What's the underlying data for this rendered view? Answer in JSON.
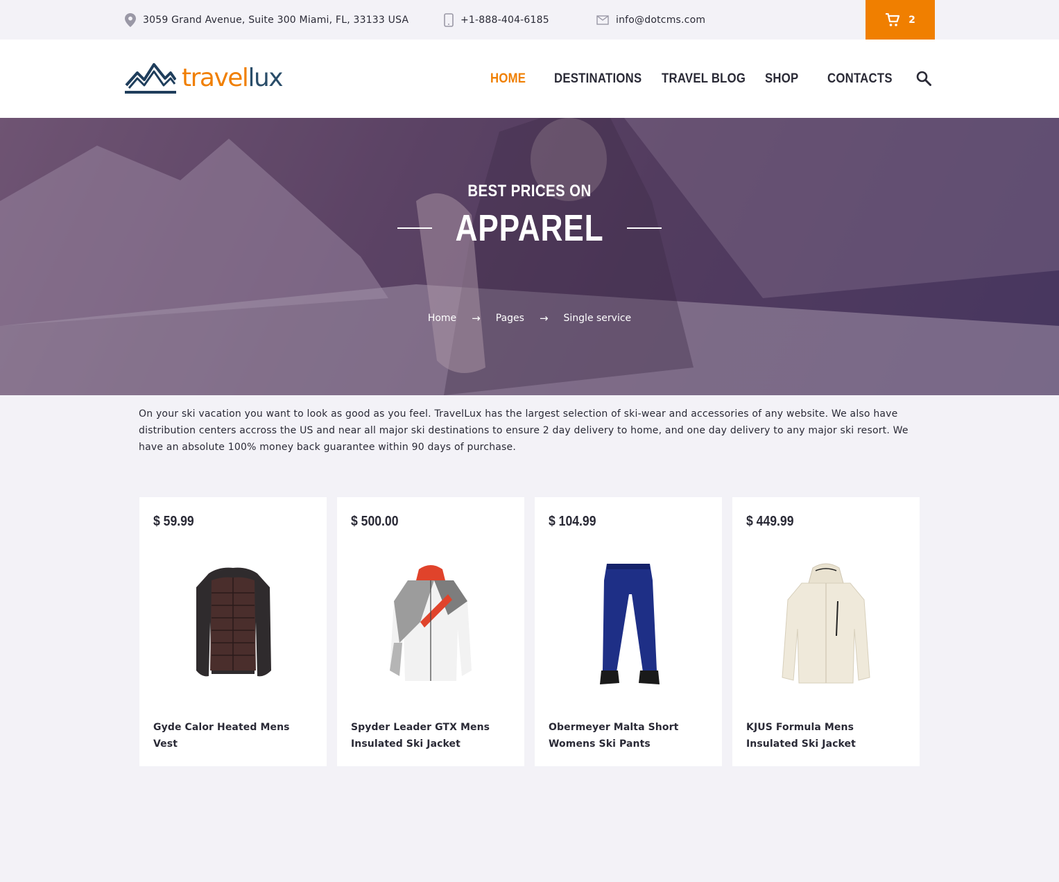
{
  "topbar": {
    "address": "3059 Grand Avenue, Suite 300 Miami, FL, 33133 USA",
    "phone": "+1-888-404-6185",
    "email": "info@dotcms.com",
    "cart_count": "2",
    "address_icon": "location-pin-icon",
    "phone_icon": "mobile-phone-icon",
    "email_icon": "envelope-icon",
    "cart_icon": "shopping-cart-icon"
  },
  "header": {
    "logo_part1": "travel",
    "logo_part2": "lux",
    "logo_icon": "mountains-logo-icon",
    "nav": [
      {
        "label": "HOME",
        "active": true
      },
      {
        "label": "DESTINATIONS",
        "active": false
      },
      {
        "label": "TRAVEL BLOG",
        "active": false
      },
      {
        "label": "SHOP",
        "active": false
      },
      {
        "label": "CONTACTS",
        "active": false
      }
    ],
    "search_icon": "search-icon"
  },
  "hero": {
    "subtitle": "BEST PRICES ON",
    "title": "APPAREL",
    "breadcrumbs": [
      "Home",
      "Pages",
      "Single service"
    ],
    "separator": "→"
  },
  "intro": {
    "text": "On your ski vacation you want to look as good as you feel. TravelLux has the largest selection of ski-wear and accessories of any website. We also have distribution centers accross the US and near all major ski destinations to ensure 2 day delivery to home, and one day delivery to any major ski resort. We have an absolute 100% money back guarantee within 90 days of purchase."
  },
  "products": [
    {
      "price": "$ 59.99",
      "name": "Gyde Calor Heated Mens Vest"
    },
    {
      "price": "$ 500.00",
      "name": "Spyder Leader GTX Mens Insulated Ski Jacket"
    },
    {
      "price": "$ 104.99",
      "name": "Obermeyer Malta Short Womens Ski Pants"
    },
    {
      "price": "$ 449.99",
      "name": "KJUS Formula Mens Insulated Ski Jacket"
    }
  ],
  "colors": {
    "accent": "#f07f00",
    "brand_blue": "#2a4d69",
    "text": "#2a2a36",
    "background": "#f3f2f7"
  }
}
